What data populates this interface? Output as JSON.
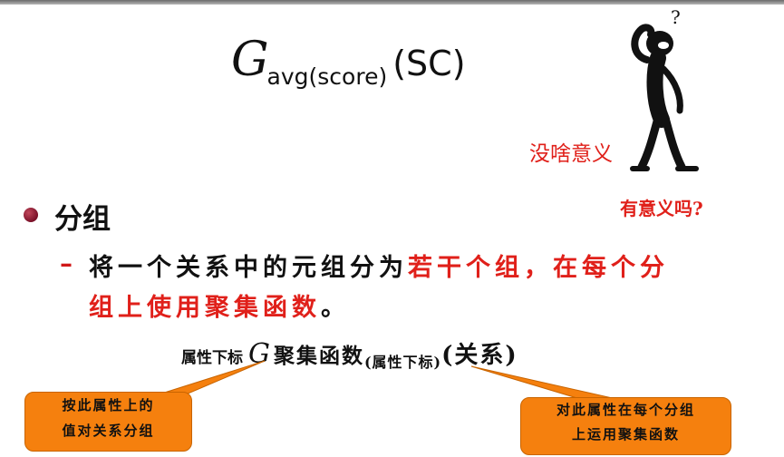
{
  "formula_top": {
    "symbol": "G",
    "subscript": "avg(score)",
    "argument": "(SC)"
  },
  "annotations": {
    "meaningless": "没啥意义",
    "meaningful_question": "有意义吗?",
    "question_mark": "?"
  },
  "bullet": {
    "title": "分组",
    "dash": "–",
    "line1_black": "将一个关系中的元组分为",
    "line1_red": "若干个组，在每个分",
    "line2_red": "组上使用聚集函数",
    "line2_end": "。"
  },
  "formula_general": {
    "left_subscript": "属性下标",
    "symbol": "G",
    "function": "聚集函数",
    "right_subscript": "(属性下标)",
    "argument": "(关系)"
  },
  "callouts": {
    "left_line1": "按此属性上的",
    "left_line2": "值对关系分组",
    "right_line1": "对此属性在每个分组",
    "right_line2": "上运用聚集函数"
  },
  "colors": {
    "accent_red": "#e0201a",
    "callout_orange": "#f5800e",
    "bullet_maroon": "#7a1028"
  }
}
